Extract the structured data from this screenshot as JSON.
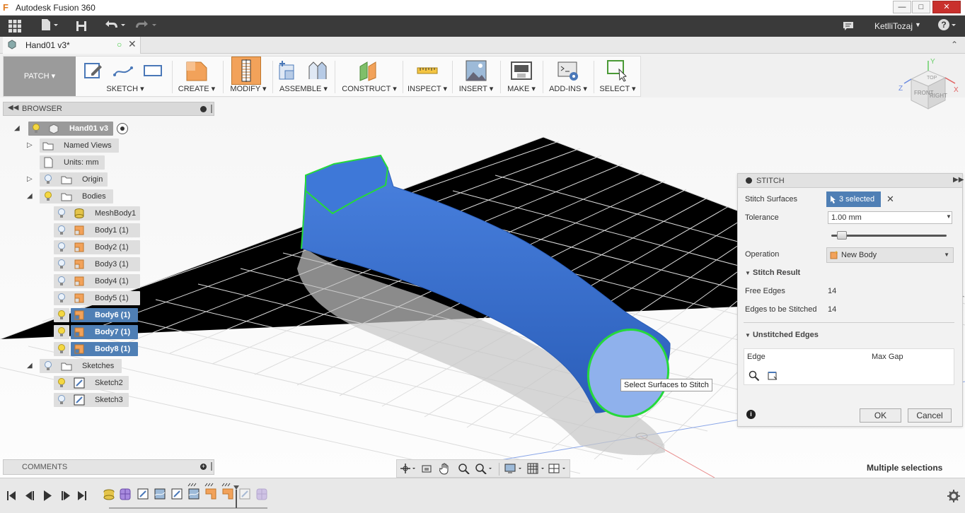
{
  "window": {
    "title": "Autodesk Fusion 360"
  },
  "user": {
    "name": "KetlliTozaj"
  },
  "doc_tab": {
    "label": "Hand01 v3*"
  },
  "workspace": {
    "label": "PATCH"
  },
  "toolbar": {
    "groups": [
      "SKETCH",
      "CREATE",
      "MODIFY",
      "ASSEMBLE",
      "CONSTRUCT",
      "INSPECT",
      "INSERT",
      "MAKE",
      "ADD-INS",
      "SELECT"
    ]
  },
  "viewcube": {
    "right": "RIGHT",
    "front": "FRONT",
    "top": "TOP",
    "x": "X",
    "y": "Y",
    "z": "Z"
  },
  "browser": {
    "title": "BROWSER",
    "root": "Hand01 v3",
    "named_views": "Named Views",
    "units": "Units: mm",
    "origin": "Origin",
    "bodies": "Bodies",
    "body_items": [
      {
        "label": "MeshBody1",
        "selected": false
      },
      {
        "label": "Body1 (1)",
        "selected": false
      },
      {
        "label": "Body2 (1)",
        "selected": false
      },
      {
        "label": "Body3 (1)",
        "selected": false
      },
      {
        "label": "Body4 (1)",
        "selected": false
      },
      {
        "label": "Body5 (1)",
        "selected": false
      },
      {
        "label": "Body6 (1)",
        "selected": true
      },
      {
        "label": "Body7 (1)",
        "selected": true
      },
      {
        "label": "Body8 (1)",
        "selected": true
      }
    ],
    "sketches": "Sketches",
    "sketch_items": [
      "Sketch2",
      "Sketch3"
    ]
  },
  "comments": {
    "title": "COMMENTS"
  },
  "tooltip": {
    "text": "Select Surfaces to Stitch"
  },
  "status": {
    "text": "Multiple selections"
  },
  "stitch": {
    "title": "STITCH",
    "surfaces_label": "Stitch Surfaces",
    "surfaces_value": "3 selected",
    "tolerance_label": "Tolerance",
    "tolerance_value": "1.00 mm",
    "tolerance_slider_fraction": 0.09,
    "operation_label": "Operation",
    "operation_value": "New Body",
    "result_header": "Stitch Result",
    "free_edges_label": "Free Edges",
    "free_edges_value": "14",
    "edges_stitched_label": "Edges to be Stitched",
    "edges_stitched_value": "14",
    "unstitched_header": "Unstitched Edges",
    "col_edge": "Edge",
    "col_maxgap": "Max Gap",
    "ok": "OK",
    "cancel": "Cancel"
  },
  "colors": {
    "accent": "#4f7fb5",
    "model": "#3a6fcf",
    "highlight": "#25d93b"
  }
}
